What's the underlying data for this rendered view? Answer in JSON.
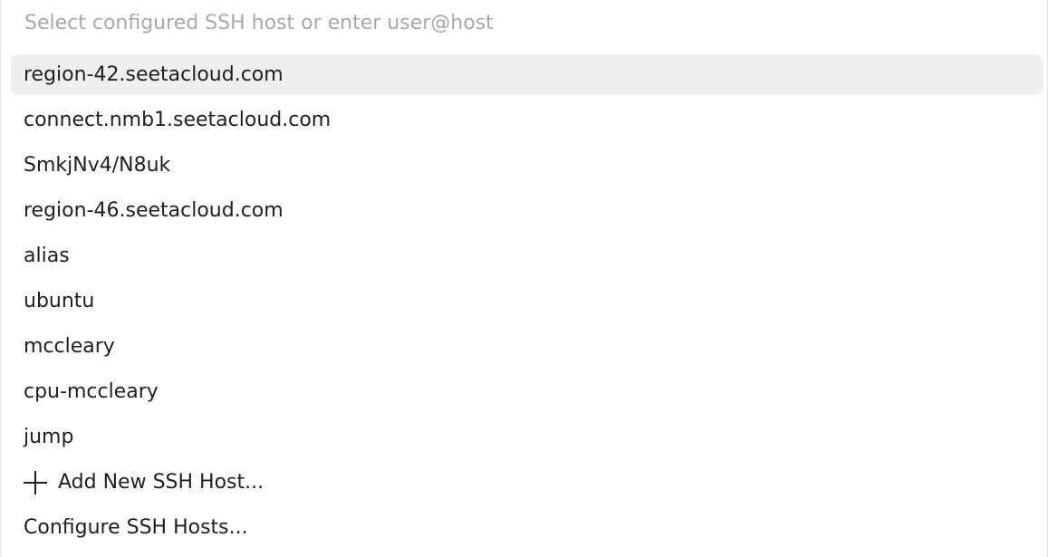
{
  "search": {
    "placeholder": "Select configured SSH host or enter user@host",
    "value": ""
  },
  "hosts": [
    {
      "label": "region-42.seetacloud.com",
      "selected": true
    },
    {
      "label": "connect.nmb1.seetacloud.com",
      "selected": false
    },
    {
      "label": "SmkjNv4/N8uk",
      "selected": false
    },
    {
      "label": "region-46.seetacloud.com",
      "selected": false
    },
    {
      "label": "alias",
      "selected": false
    },
    {
      "label": "ubuntu",
      "selected": false
    },
    {
      "label": "mccleary",
      "selected": false
    },
    {
      "label": "cpu-mccleary",
      "selected": false
    },
    {
      "label": "jump",
      "selected": false
    }
  ],
  "actions": {
    "add_new_host": {
      "label": "Add New SSH Host...",
      "icon": "plus-icon"
    },
    "configure_hosts": {
      "label": "Configure SSH Hosts..."
    }
  },
  "colors": {
    "selected_background": "#efeff1",
    "placeholder": "#a8a8a8",
    "text": "#1f1f1f"
  }
}
